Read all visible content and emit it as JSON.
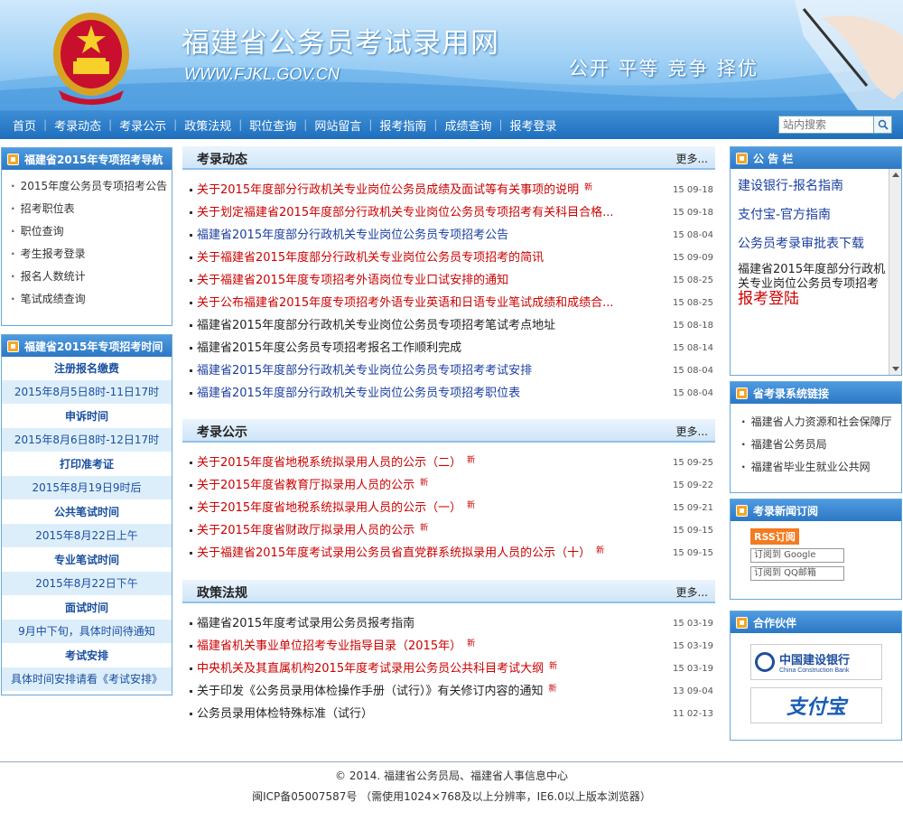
{
  "header": {
    "title": "福建省公务员考试录用网",
    "url": "WWW.FJKL.GOV.CN",
    "slogan": "公开 平等 竞争 择优"
  },
  "nav": {
    "items": [
      "首页",
      "考录动态",
      "考录公示",
      "政策法规",
      "职位查询",
      "网站留言",
      "报考指南",
      "成绩查询",
      "报考登录"
    ],
    "search_placeholder": "站内搜索"
  },
  "left_nav": {
    "title": "福建省2015年专项招考导航",
    "items": [
      "2015年度公务员专项招考公告",
      "招考职位表",
      "职位查询",
      "考生报考登录",
      "报名人数统计",
      "笔试成绩查询"
    ]
  },
  "left_time": {
    "title": "福建省2015年专项招考时间",
    "items": [
      {
        "t": "注册报名缴费",
        "v": "2015年8月5日8时-11日17时"
      },
      {
        "t": "申诉时间",
        "v": "2015年8月6日8时-12日17时"
      },
      {
        "t": "打印准考证",
        "v": "2015年8月19日9时后"
      },
      {
        "t": "公共笔试时间",
        "v": "2015年8月22日上午"
      },
      {
        "t": "专业笔试时间",
        "v": "2015年8月22日下午"
      },
      {
        "t": "面试时间",
        "v": "9月中下旬，具体时间待通知"
      },
      {
        "t": "考试安排",
        "v": "具体时间安排请看《考试安排》"
      }
    ]
  },
  "sections": {
    "more": "更多...",
    "dynamics": {
      "title": "考录动态",
      "items": [
        {
          "text": "关于2015年度部分行政机关专业岗位公务员成绩及面试等有关事项的说明",
          "date": "15 09-18",
          "color": "red",
          "new": "新"
        },
        {
          "text": "关于划定福建省2015年度部分行政机关专业岗位公务员专项招考有关科目合格...",
          "date": "15 09-18",
          "color": "red",
          "new": ""
        },
        {
          "text": "福建省2015年度部分行政机关专业岗位公务员专项招考公告",
          "date": "15 08-04",
          "color": "blue",
          "new": ""
        },
        {
          "text": "关于福建省2015年度部分行政机关专业岗位公务员专项招考的简讯",
          "date": "15 09-09",
          "color": "red",
          "new": ""
        },
        {
          "text": "关于福建省2015年度专项招考外语岗位专业口试安排的通知",
          "date": "15 08-25",
          "color": "red",
          "new": ""
        },
        {
          "text": "关于公布福建省2015年度专项招考外语专业英语和日语专业笔试成绩和成绩合...",
          "date": "15 08-25",
          "color": "red",
          "new": ""
        },
        {
          "text": "福建省2015年度部分行政机关专业岗位公务员专项招考笔试考点地址",
          "date": "15 08-18",
          "color": "black",
          "new": ""
        },
        {
          "text": "福建省2015年度公务员专项招考报名工作顺利完成",
          "date": "15 08-14",
          "color": "black",
          "new": ""
        },
        {
          "text": "福建省2015年度部分行政机关专业岗位公务员专项招考考试安排",
          "date": "15 08-04",
          "color": "blue",
          "new": ""
        },
        {
          "text": "福建省2015年度部分行政机关专业岗位公务员专项招考职位表",
          "date": "15 08-04",
          "color": "blue",
          "new": ""
        }
      ]
    },
    "publicity": {
      "title": "考录公示",
      "items": [
        {
          "text": "关于2015年度省地税系统拟录用人员的公示（二）",
          "date": "15 09-25",
          "color": "red",
          "new": "新"
        },
        {
          "text": "关于2015年度省教育厅拟录用人员的公示",
          "date": "15 09-22",
          "color": "red",
          "new": "新"
        },
        {
          "text": "关于2015年度省地税系统拟录用人员的公示（一）",
          "date": "15 09-21",
          "color": "red",
          "new": "新"
        },
        {
          "text": "关于2015年度省财政厅拟录用人员的公示",
          "date": "15 09-15",
          "color": "red",
          "new": "新"
        },
        {
          "text": "关于福建省2015年度考试录用公务员省直党群系统拟录用人员的公示（十）",
          "date": "15 09-15",
          "color": "red",
          "new": "新"
        }
      ]
    },
    "policy": {
      "title": "政策法规",
      "items": [
        {
          "text": "福建省2015年度考试录用公务员报考指南",
          "date": "15 03-19",
          "color": "black",
          "new": ""
        },
        {
          "text": "福建省机关事业单位招考专业指导目录（2015年）",
          "date": "15 03-19",
          "color": "red",
          "new": "新"
        },
        {
          "text": "中央机关及其直属机构2015年度考试录用公务员公共科目考试大纲",
          "date": "15 03-19",
          "color": "red",
          "new": "新"
        },
        {
          "text": "关于印发《公务员录用体检操作手册（试行）》有关修订内容的通知",
          "date": "13 09-04",
          "color": "black",
          "new": "新"
        },
        {
          "text": "公务员录用体检特殊标准（试行）",
          "date": "11 02-13",
          "color": "black",
          "new": ""
        }
      ]
    }
  },
  "notice": {
    "title": "公 告 栏",
    "links": [
      "建设银行-报名指南",
      "支付宝-官方指南",
      "公务员考录审批表下载"
    ],
    "text": "福建省2015年度部分行政机关专业岗位公务员专项招考",
    "highlight": "报考登陆"
  },
  "sys_links": {
    "title": "省考录系统链接",
    "items": [
      "福建省人力资源和社会保障厅",
      "福建省公务员局",
      "福建省毕业生就业公共网"
    ]
  },
  "subscribe": {
    "title": "考录新闻订阅",
    "rss": "RSS订阅",
    "google": "订阅到 Google",
    "qq": "订阅到 QQ邮箱"
  },
  "partners": {
    "title": "合作伙伴",
    "ccb_cn": "中国建设银行",
    "ccb_en": "China Construction Bank",
    "alipay": "支付宝"
  },
  "footer": {
    "line1": "© 2014. 福建省公务员局、福建省人事信息中心",
    "line2": "闽ICP备05007587号    （需使用1024×768及以上分辨率，IE6.0以上版本浏览器）"
  },
  "colors": {
    "nav": "#2a7cc7",
    "red": "#cc0000",
    "blue": "#1a3fa0"
  }
}
